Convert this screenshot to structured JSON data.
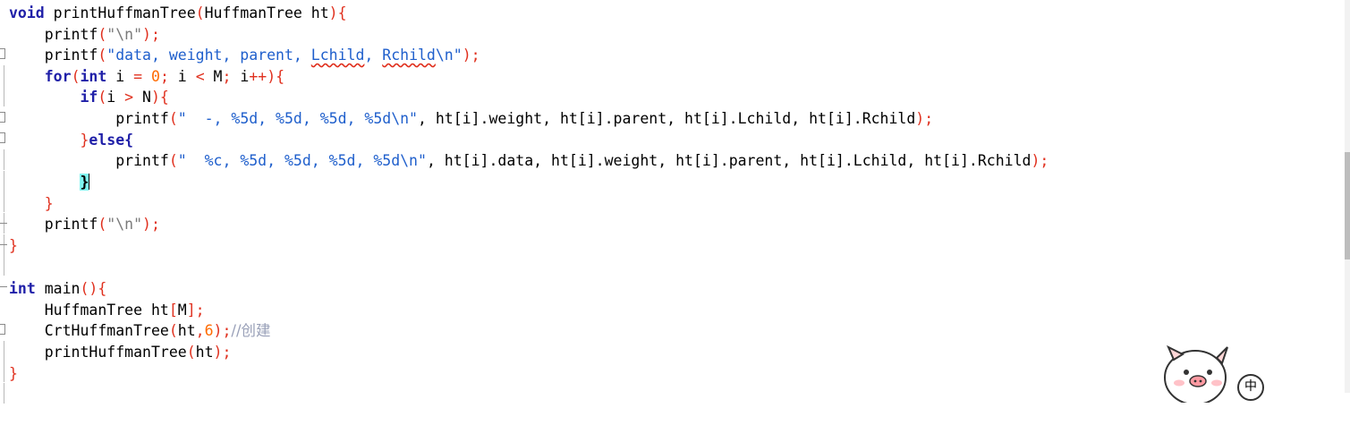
{
  "editor": {
    "language": "C",
    "lines": {
      "l1": {
        "kw1": "void",
        "name": " printHuffmanTree",
        "p1": "(",
        "args": "HuffmanTree ht",
        "p2": ")",
        "b": "{"
      },
      "l2": {
        "indent": "    ",
        "fn": "printf",
        "p1": "(",
        "s": "\"\\n\"",
        "p2": ")",
        "sc": ";"
      },
      "l3": {
        "indent": "    ",
        "fn": "printf",
        "p1": "(",
        "s1": "\"data, weight, parent, ",
        "s2": "Lchild",
        "s3": ", ",
        "s4": "Rchild",
        "s5": "\\n\"",
        "p2": ")",
        "sc": ";"
      },
      "l4": {
        "indent": "    ",
        "kw1": "for",
        "p1": "(",
        "kw2": "int",
        "a": " i ",
        "eq": "=",
        "sp": " ",
        "n0": "0",
        "sc1": ";",
        "b": " i ",
        "lt": "<",
        "c": " M",
        "sc2": ";",
        "d": " i",
        "pp": "++",
        "p2": ")",
        "br": "{"
      },
      "l5": {
        "indent": "        ",
        "kw": "if",
        "p1": "(",
        "a": "i ",
        "gt": ">",
        "b": " N",
        "p2": ")",
        "br": "{"
      },
      "l6": {
        "indent": "            ",
        "fn": "printf",
        "p1": "(",
        "s1": "\"  ",
        "s2": "-, %5d, %5d, %5d, %5d\\n\"",
        "rest": ", ht[i].weight, ht[i].parent, ht[i].Lchild, ht[i].Rchild",
        "p2": ")",
        "sc": ";"
      },
      "l7": {
        "indent": "        ",
        "b1": "}",
        "kw": "else",
        "b2": "{"
      },
      "l8": {
        "indent": "            ",
        "fn": "printf",
        "p1": "(",
        "s1": "\"  ",
        "s2": "%c, %5d, %5d, %5d, %5d\\n\"",
        "rest": ", ht[i].data, ht[i].weight, ht[i].parent, ht[i].Lchild, ht[i].Rchild",
        "p2": ")",
        "sc": ";"
      },
      "l9": {
        "indent": "        ",
        "b": "}"
      },
      "l10": {
        "indent": "    ",
        "b": "}"
      },
      "l11": {
        "indent": "    ",
        "fn": "printf",
        "p1": "(",
        "s": "\"\\n\"",
        "p2": ")",
        "sc": ";"
      },
      "l12": {
        "b": "}"
      },
      "l13": {
        "text": ""
      },
      "l14": {
        "kw": "int",
        "name": " main",
        "p": "()",
        "b": "{"
      },
      "l15": {
        "indent": "    ",
        "a": "HuffmanTree ht",
        "lb": "[",
        "m": "M",
        "rb": "]",
        "sc": ";"
      },
      "l16": {
        "indent": "    ",
        "fn": "CrtHuffmanTree",
        "p1": "(",
        "a": "ht",
        "cm": ",",
        "n": "6",
        "p2": ")",
        "sc": ";",
        "comment": "//创建"
      },
      "l17": {
        "indent": "    ",
        "fn": "printHuffmanTree",
        "p1": "(",
        "a": "ht",
        "p2": ")",
        "sc": ";"
      },
      "l18": {
        "b": "}"
      }
    }
  },
  "ime": {
    "label": "中"
  },
  "colors": {
    "keyword": "#1f1fa8",
    "operator": "#e0301e",
    "number": "#ff6a00",
    "comment": "#99a0b8",
    "bracket_highlight": "#7ff5f0"
  },
  "icons": {
    "mascot": "pig-mascot-icon",
    "ime": "ime-indicator-icon"
  }
}
